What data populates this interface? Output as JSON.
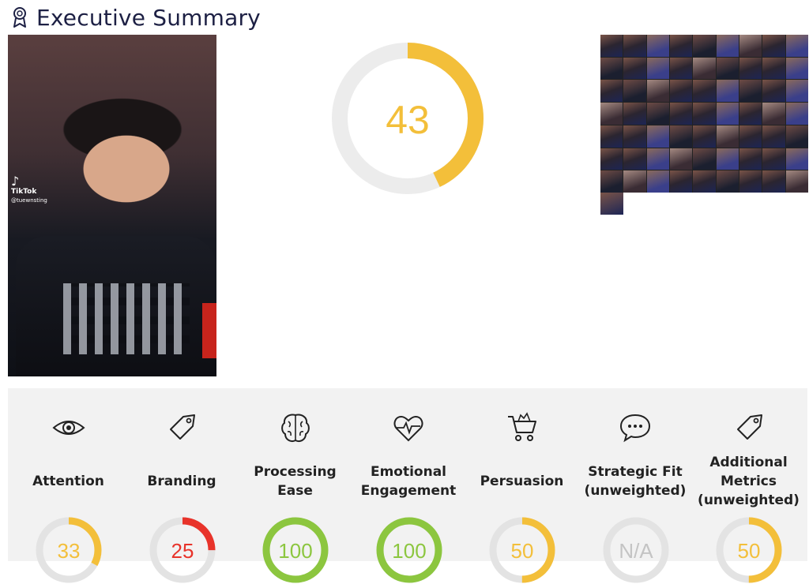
{
  "header": {
    "title": "Executive Summary",
    "icon": "award-ribbon-icon"
  },
  "thumbnail": {
    "watermark_brand": "TikTok",
    "watermark_handle": "@tuewnsting"
  },
  "overall_score": {
    "value": "43",
    "fraction": 0.43,
    "color": "#f3bf3a",
    "track_color": "#ececec"
  },
  "metrics": [
    {
      "label": "Attention",
      "icon": "eye-icon",
      "score": "33",
      "fraction": 0.33,
      "color": "#f3bf3a"
    },
    {
      "label": "Branding",
      "icon": "tag-icon",
      "score": "25",
      "fraction": 0.25,
      "color": "#e8332a"
    },
    {
      "label": "Processing Ease",
      "icon": "brain-icon",
      "score": "100",
      "fraction": 1.0,
      "color": "#8cc63f"
    },
    {
      "label": "Emotional Engagement",
      "icon": "heart-pulse-icon",
      "score": "100",
      "fraction": 1.0,
      "color": "#8cc63f"
    },
    {
      "label": "Persuasion",
      "icon": "shopping-cart-icon",
      "score": "50",
      "fraction": 0.5,
      "color": "#f3bf3a"
    },
    {
      "label": "Strategic Fit (unweighted)",
      "icon": "chat-bubble-icon",
      "score": "N/A",
      "fraction": 0,
      "color": "#c9c9c9"
    },
    {
      "label": "Additional Metrics (unweighted)",
      "icon": "tag-icon",
      "score": "50",
      "fraction": 0.5,
      "color": "#f3bf3a"
    }
  ]
}
